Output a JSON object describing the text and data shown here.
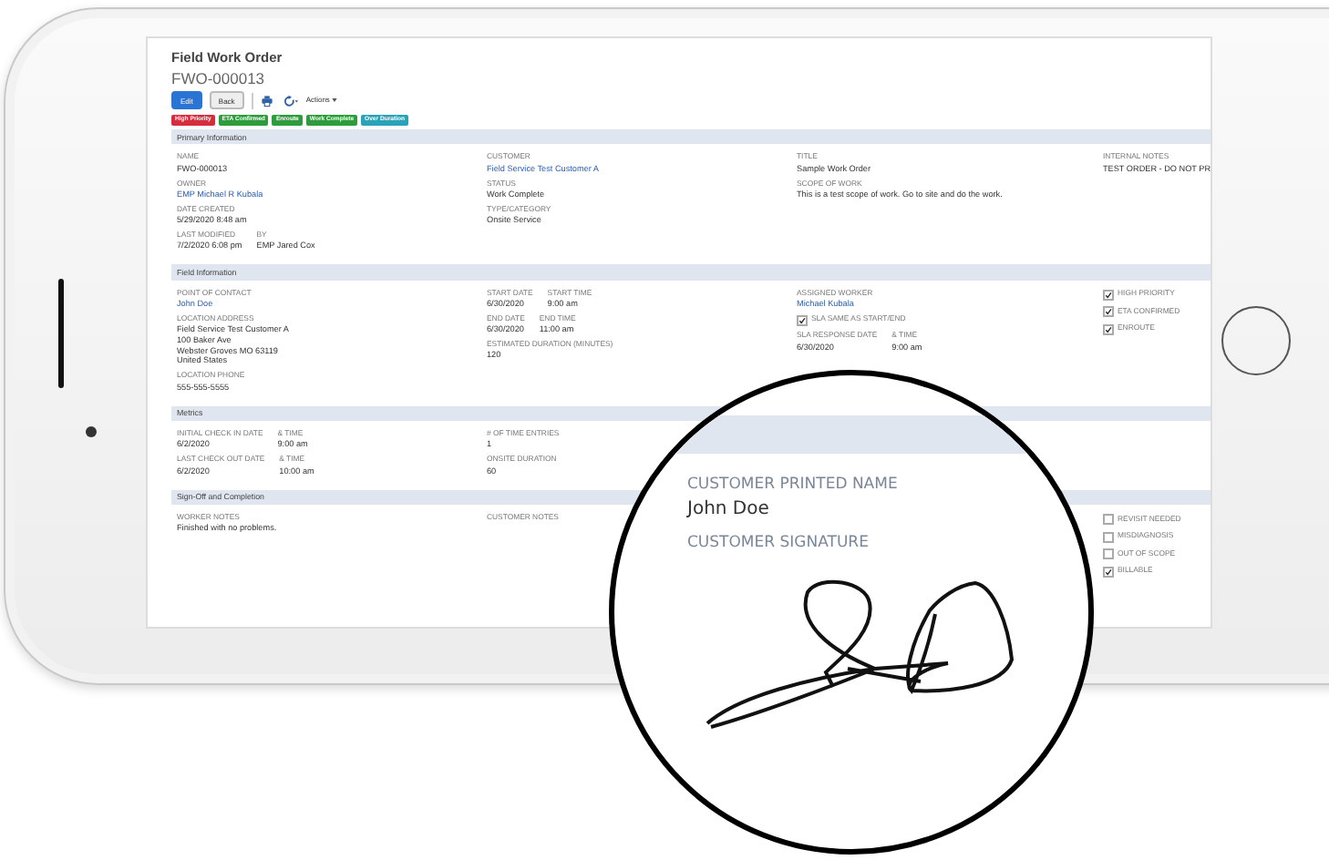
{
  "record": {
    "heading": "Field Work Order",
    "number": "FWO-000013"
  },
  "toolbar": {
    "buttons": [
      {
        "label": "Edit",
        "kind": "primary"
      },
      {
        "label": "Back",
        "kind": "secondary"
      }
    ],
    "menu": "Actions"
  },
  "badges": [
    {
      "label": "High Priority",
      "color": "#d62d3e"
    },
    {
      "label": "ETA Confirmed",
      "color": "#2e9b3c"
    },
    {
      "label": "Enroute",
      "color": "#2e9b3c"
    },
    {
      "label": "Work Complete",
      "color": "#2e9b3c"
    },
    {
      "label": "Over Duration",
      "color": "#2aa3b8"
    }
  ],
  "sections": [
    {
      "title": "Primary Information",
      "columns": [
        [
          {
            "kind": "field",
            "label": "NAME",
            "lines": [
              "FWO-000013"
            ],
            "link": false
          },
          {
            "kind": "field",
            "label": "OWNER",
            "lines": [
              "EMP Michael R Kubala"
            ],
            "link": true
          },
          {
            "kind": "field",
            "label": "DATE CREATED",
            "lines": [
              "5/29/2020 8:48 am"
            ],
            "link": false
          },
          {
            "kind": "pair",
            "parts": [
              {
                "label": "LAST MODIFIED",
                "value": "7/2/2020 6:08 pm"
              },
              {
                "label": "BY",
                "value": "EMP Jared Cox"
              }
            ]
          }
        ],
        [
          {
            "kind": "field",
            "label": "CUSTOMER",
            "lines": [
              "Field Service Test Customer A"
            ],
            "link": true
          },
          {
            "kind": "field",
            "label": "STATUS",
            "lines": [
              "Work Complete"
            ],
            "link": false
          },
          {
            "kind": "field",
            "label": "TYPE/CATEGORY",
            "lines": [
              "Onsite Service"
            ],
            "link": false
          }
        ],
        [
          {
            "kind": "field",
            "label": "TITLE",
            "lines": [
              "Sample Work Order"
            ],
            "link": false
          },
          {
            "kind": "field",
            "label": "SCOPE OF WORK",
            "lines": [
              "This is a test scope of work. Go to site and do the work."
            ],
            "link": false
          }
        ],
        [
          {
            "kind": "field",
            "label": "INTERNAL NOTES",
            "lines": [
              "TEST ORDER - DO NOT PR"
            ],
            "link": false
          }
        ]
      ]
    },
    {
      "title": "Field Information",
      "columns": [
        [
          {
            "kind": "field",
            "label": "POINT OF CONTACT",
            "lines": [
              "John Doe"
            ],
            "link": true
          },
          {
            "kind": "field",
            "label": "LOCATION ADDRESS",
            "lines": [
              "Field Service Test Customer A",
              "100 Baker Ave",
              "Webster Groves MO 63119",
              "United States"
            ],
            "link": false
          },
          {
            "kind": "field",
            "label": "LOCATION PHONE",
            "lines": [
              "555-555-5555"
            ],
            "link": false
          }
        ],
        [
          {
            "kind": "pair",
            "parts": [
              {
                "label": "START DATE",
                "value": "6/30/2020"
              },
              {
                "label": "START TIME",
                "value": "9:00 am"
              }
            ]
          },
          {
            "kind": "pair",
            "parts": [
              {
                "label": "END DATE",
                "value": "6/30/2020"
              },
              {
                "label": "END TIME",
                "value": "11:00 am"
              }
            ]
          },
          {
            "kind": "field",
            "label": "ESTIMATED DURATION (MINUTES)",
            "lines": [
              "120"
            ],
            "link": false
          }
        ],
        [
          {
            "kind": "field",
            "label": "ASSIGNED WORKER",
            "lines": [
              "Michael Kubala"
            ],
            "link": true
          },
          {
            "kind": "checkbox",
            "label": "SLA SAME AS START/END",
            "checked": true
          },
          {
            "kind": "pair",
            "parts": [
              {
                "label": "SLA RESPONSE DATE",
                "value": "6/30/2020"
              },
              {
                "label": "& TIME",
                "value": "9:00 am"
              }
            ]
          }
        ],
        [
          {
            "kind": "checkbox",
            "label": "HIGH PRIORITY",
            "checked": true
          },
          {
            "kind": "checkbox",
            "label": "ETA CONFIRMED",
            "checked": true
          },
          {
            "kind": "checkbox",
            "label": "ENROUTE",
            "checked": true
          }
        ]
      ]
    },
    {
      "title": "Metrics",
      "columns": [
        [
          {
            "kind": "pair",
            "parts": [
              {
                "label": "INITIAL CHECK IN DATE",
                "value": "6/2/2020"
              },
              {
                "label": "& TIME",
                "value": "9:00 am"
              }
            ]
          },
          {
            "kind": "pair",
            "parts": [
              {
                "label": "LAST CHECK OUT DATE",
                "value": "6/2/2020"
              },
              {
                "label": "& TIME",
                "value": "10:00 am"
              }
            ]
          }
        ],
        [
          {
            "kind": "field",
            "label": "# OF TIME ENTRIES",
            "lines": [
              "1"
            ],
            "link": false
          },
          {
            "kind": "field",
            "label": "ONSITE DURATION",
            "lines": [
              "60"
            ],
            "link": false
          }
        ],
        [],
        []
      ]
    },
    {
      "title": "Sign-Off and Completion",
      "columns": [
        [
          {
            "kind": "field",
            "label": "WORKER NOTES",
            "lines": [
              "Finished with no problems."
            ],
            "link": false
          }
        ],
        [
          {
            "kind": "field",
            "label": "CUSTOMER NOTES"
          }
        ],
        [],
        [
          {
            "kind": "checkbox",
            "label": "REVISIT NEEDED",
            "checked": false
          },
          {
            "kind": "checkbox",
            "label": "MISDIAGNOSIS",
            "checked": false
          },
          {
            "kind": "checkbox",
            "label": "OUT OF SCOPE",
            "checked": false
          },
          {
            "kind": "checkbox",
            "label": "BILLABLE",
            "checked": true
          }
        ]
      ]
    }
  ],
  "magnifier": {
    "fields": [
      {
        "kind": "text",
        "label": "CUSTOMER PRINTED NAME",
        "value": "John Doe"
      },
      {
        "kind": "signature",
        "label": "CUSTOMER SIGNATURE"
      }
    ]
  }
}
